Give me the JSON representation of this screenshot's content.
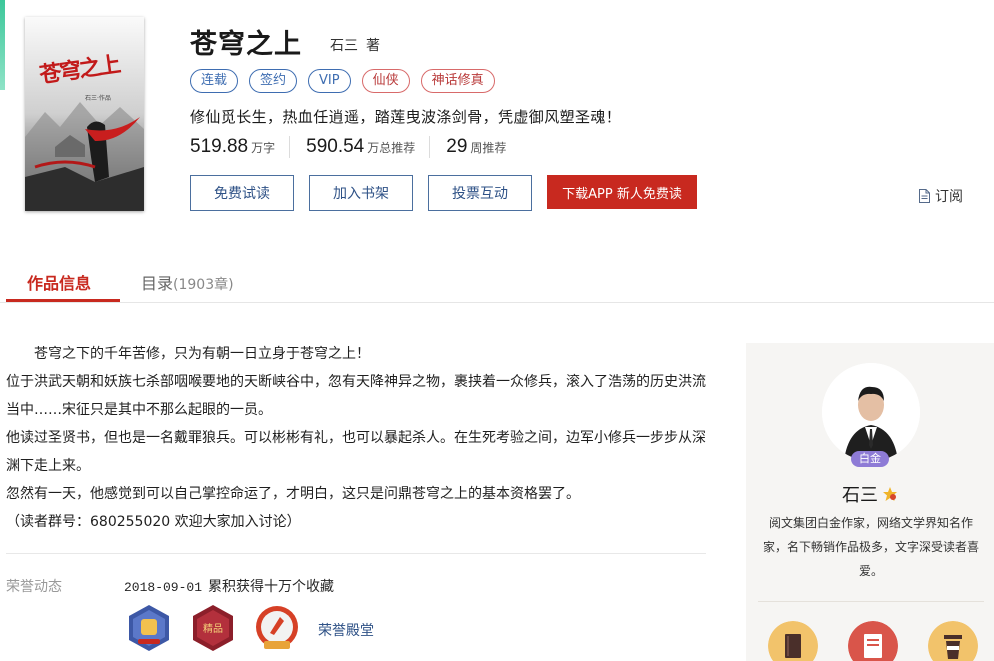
{
  "book": {
    "title": "苍穹之上",
    "author": "石三",
    "author_suffix": "著",
    "tags": [
      {
        "label": "连载",
        "style": "blue"
      },
      {
        "label": "签约",
        "style": "blue"
      },
      {
        "label": "VIP",
        "style": "blue"
      },
      {
        "label": "仙侠",
        "style": "red"
      },
      {
        "label": "神话修真",
        "style": "red"
      }
    ],
    "tagline": "修仙觅长生，热血任逍遥，踏莲曳波涤剑骨，凭虚御风塑圣魂！",
    "stats": [
      {
        "value": "519.88",
        "unit": "万字"
      },
      {
        "value": "590.54",
        "unit": "万总推荐"
      },
      {
        "value": "29",
        "unit": "周推荐"
      }
    ],
    "cover": {
      "title_art": "苍穹之上",
      "author_art": "石三·作品"
    }
  },
  "actions": {
    "free_read": "免费试读",
    "add_shelf": "加入书架",
    "vote": "投票互动",
    "download_app": "下载APP 新人免费读",
    "subscribe": "订阅"
  },
  "tabs": {
    "info": "作品信息",
    "toc": "目录",
    "toc_count": "(1903章)"
  },
  "description": [
    "苍穹之下的千年苦修，只为有朝一日立身于苍穹之上！",
    "位于洪武天朝和妖族七杀部咽喉要地的天断峡谷中，忽有天降神异之物，裹挟着一众修兵，滚入了浩荡的历史洪流当中……宋征只是其中不那么起眼的一员。",
    "他读过圣贤书，但也是一名戴罪狼兵。可以彬彬有礼，也可以暴起杀人。在生死考验之间，边军小修兵一步步从深渊下走上来。",
    "忽然有一天，他感觉到可以自己掌控命运了，才明白，这只是问鼎苍穹之上的基本资格罢了。",
    "（读者群号：680255020 欢迎大家加入讨论）"
  ],
  "honor": {
    "label": "荣誉动态",
    "date": "2018-09-01",
    "event": "累积获得十万个收藏",
    "medals": [
      "fist-medal",
      "jingpin-medal",
      "top-medal"
    ],
    "hall_link": "荣誉殿堂"
  },
  "author_panel": {
    "badge": "白金",
    "name": "石三",
    "bio": "阅文集团白金作家，网络文学界知名作家，名下畅销作品极多，文字深受读者喜爱。",
    "icons": [
      "book-icon",
      "document-icon",
      "cup-icon"
    ]
  },
  "colors": {
    "accent_red": "#c8291f",
    "link_blue": "#2e5186",
    "badge_purple": "#8e7bd6"
  }
}
